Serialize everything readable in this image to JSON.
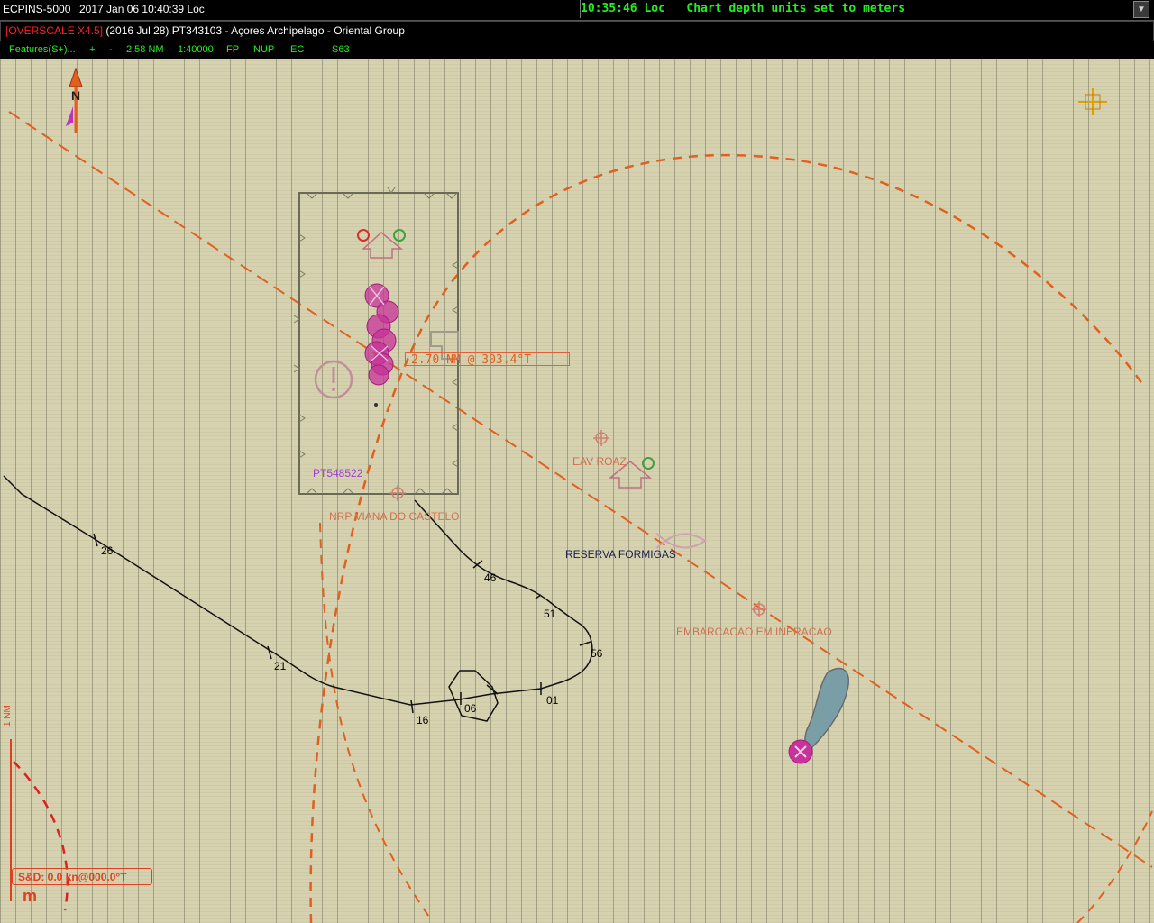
{
  "topbar": {
    "app_title": "ECPINS-5000",
    "system_datetime": "2017 Jan 06   10:40:39 Loc",
    "message": "10:35:46 Loc   Chart depth units set to meters",
    "dropdown_icon": "dropdown-arrow-icon"
  },
  "chart_bar": {
    "overscale": "[OVERSCALE X4.5]",
    "chart_info": " (2016 Jul 28) PT343103 - Açores Archipelago - Oriental Group"
  },
  "status_bar": {
    "features": "Features(S+)...",
    "zoom_in": "+",
    "zoom_out": "-",
    "range": "2.58 NM",
    "scale": "1:40000",
    "fp": "FP",
    "orientation": "NUP",
    "ec": "EC",
    "s63": "S63"
  },
  "map": {
    "ebl_readout": "2.70 NM @ 303.4°T",
    "cell_label": "PT548522",
    "labels": {
      "nrp": "NRP VIANA DO CASTELO",
      "eav": "EAV ROAZ",
      "reserva": "RESERVA FORMIGAS",
      "embarcacao": "EMBARCACAO EM INERACAO"
    },
    "track_ticks": [
      "26",
      "21",
      "16",
      "06",
      "01",
      "56",
      "51",
      "46"
    ],
    "sd_box": "S&D: 0.0 kn@000.0°T",
    "depth_unit": "m",
    "scale_label": "1 NM",
    "north_arrow_letter": "N",
    "icons": {
      "north": "north-arrow-icon",
      "cursor": "crosshair-cursor-icon",
      "caution": "caution-icon",
      "wreck": "wreck-icon",
      "fish": "fish-haven-icon"
    }
  },
  "colors": {
    "sea": "#d6d2b0",
    "route": "#e06020",
    "own_ship": "#c8329a",
    "status_text": "#22ee22",
    "overscale": "#ff2020"
  }
}
